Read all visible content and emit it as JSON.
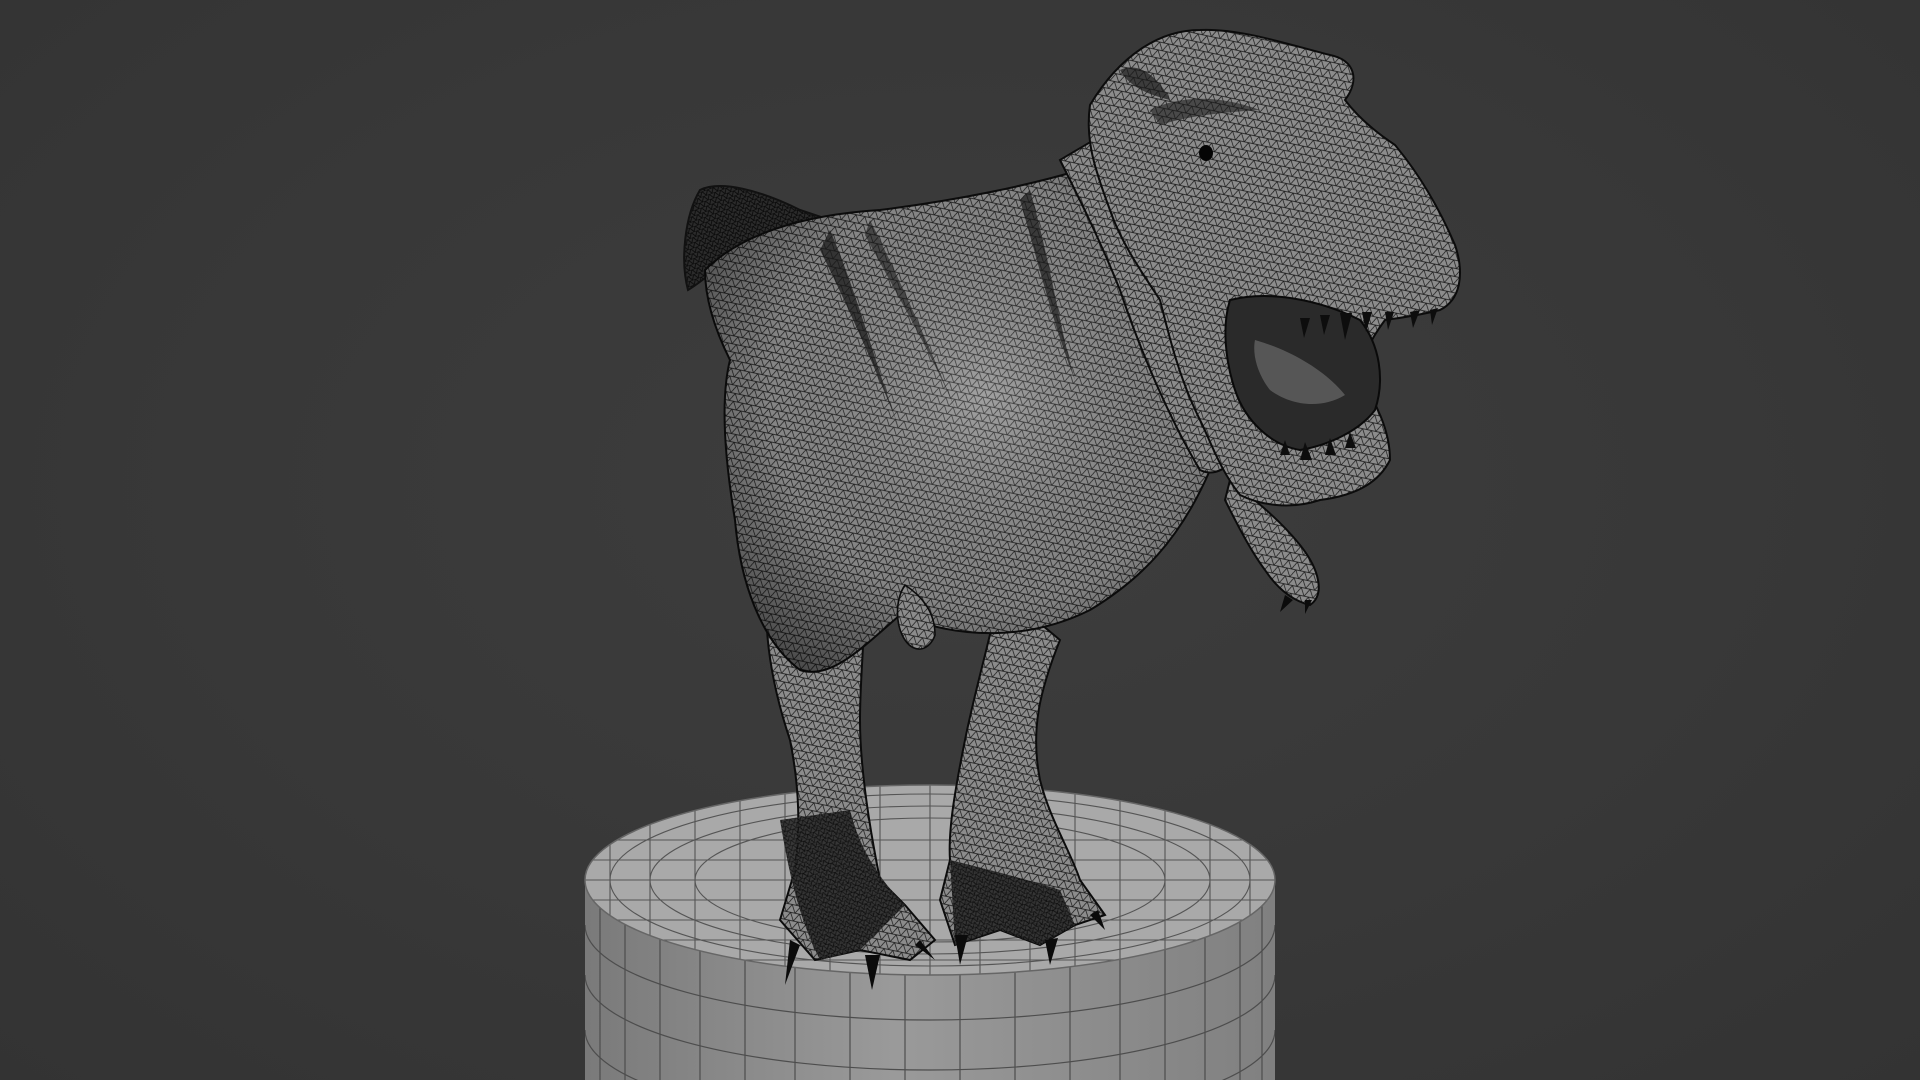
{
  "viewport": {
    "background_color": "#393939",
    "shading": "wireframe-on-solid",
    "subject": "tyrannosaurus-model",
    "pedestal": "cylinder-quad-mesh"
  },
  "colors": {
    "mesh_light": "#8a8a8a",
    "mesh_dark": "#1c1c1c",
    "wire": "#101010",
    "pedestal_top": "#a6a6a6",
    "pedestal_side": "#8e8e8e",
    "pedestal_wire": "#4a4a4a"
  }
}
